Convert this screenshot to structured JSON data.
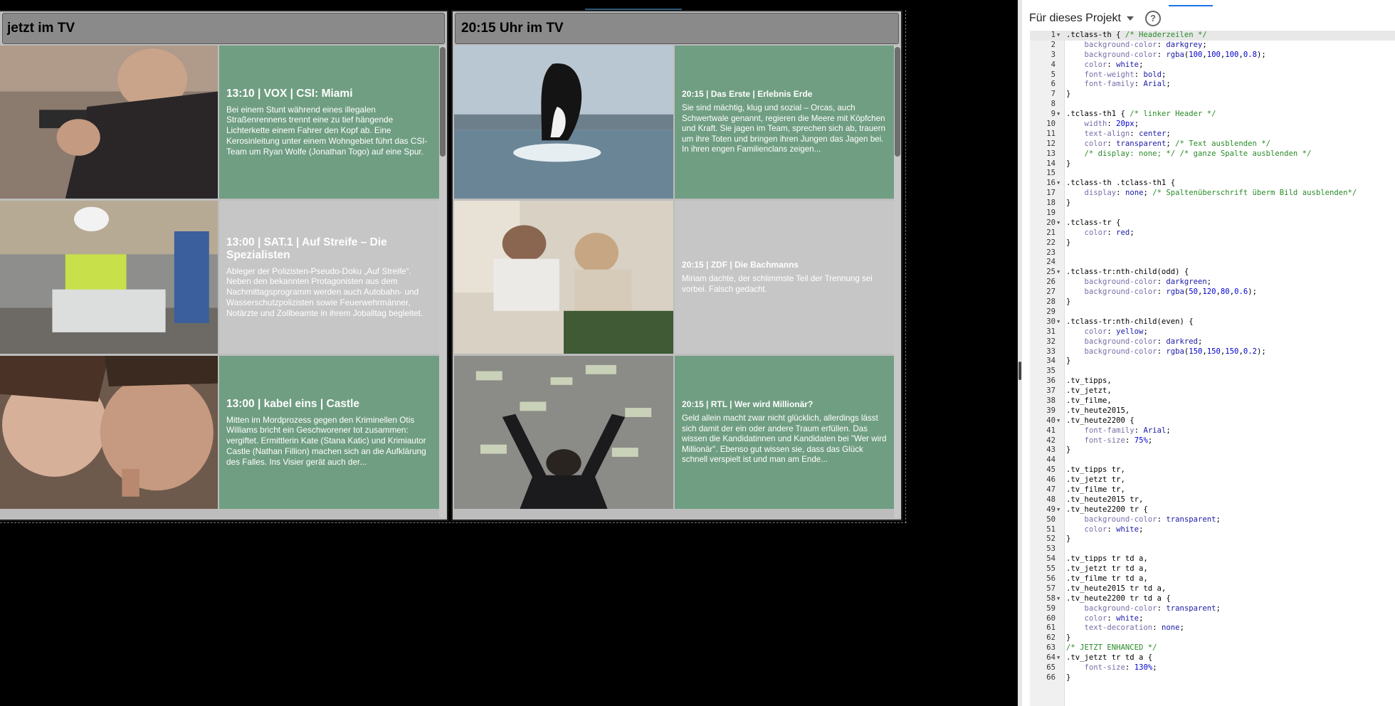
{
  "preview": {
    "panels": [
      {
        "id": "jetzt",
        "header": "jetzt im TV",
        "rows": [
          {
            "title": "13:10 | VOX | CSI: Miami",
            "description": "Bei einem Stunt während eines illegalen Straßenrennens trennt eine zu tief hängende Lichterkette einem Fahrer den Kopf ab. Eine Kerosinleitung unter einem Wohngebiet führt das CSI-Team um Ryan Wolfe (Jonathan Togo) auf eine Spur.",
            "image": "man-with-gun"
          },
          {
            "title": "13:00 | SAT.1 | Auf Streife – Die Spezialisten",
            "description": "Ableger der Polizisten-Pseudo-Doku „Auf Streife“. Neben den bekannten Protagonisten aus dem Nachmittagsprogramm werden auch Autobahn- und Wasserschutzpolizisten sowie Feuerwehrmänner, Notärzte und Zollbeamte in ihrem Joballtag begleitet.",
            "image": "police-motorcycle"
          },
          {
            "title": "13:00 | kabel eins | Castle",
            "description": "Mitten im Mordprozess gegen den Kriminellen Otis Williams bricht ein Geschworener tot zusammen: vergiftet. Ermittlerin Kate (Stana Katic) und Krimiautor Castle (Nathan Fillion) machen sich an die Aufklärung des Falles. Ins Visier gerät auch der...",
            "image": "castle-couple"
          }
        ]
      },
      {
        "id": "2015",
        "header": "20:15 Uhr im TV",
        "rows": [
          {
            "title": "20:15 | Das Erste | Erlebnis Erde",
            "description": "Sie sind mächtig, klug und sozial – Orcas, auch Schwertwale genannt, regieren die Meere mit Köpfchen und Kraft. Sie jagen im Team, sprechen sich ab, trauern um ihre Toten und bringen ihren Jungen das Jagen bei. In ihren engen Familienclans zeigen...",
            "image": "orca-jumping"
          },
          {
            "title": "20:15 | ZDF | Die Bachmanns",
            "description": "Miriam dachte, der schlimmste Teil der Trennung sei vorbei. Falsch gedacht.",
            "image": "couple-sitting"
          },
          {
            "title": "20:15 | RTL | Wer wird Millionär?",
            "description": "Geld allein macht zwar nicht glücklich, allerdings lässt sich damit der ein oder andere Traum erfüllen. Das wissen die Kandidatinnen und Kandidaten bei \"Wer wird Millionär\". Ebenso gut wissen sie, dass das Glück schnell verspielt ist und man am Ende...",
            "image": "money-rain"
          }
        ]
      }
    ]
  },
  "editor": {
    "project_label": "Für dieses Projekt",
    "help_icon": "question-circle-icon",
    "lines": [
      {
        "n": 1,
        "fold": true,
        "segs": [
          [
            "sel",
            ".tclass-th { "
          ],
          [
            "cm",
            "/* Headerzeilen */"
          ]
        ]
      },
      {
        "n": 2,
        "segs": [
          [
            "prop",
            "    background-color"
          ],
          [
            "sel",
            ": "
          ],
          [
            "kw",
            "darkgrey"
          ],
          [
            "sel",
            ";"
          ]
        ]
      },
      {
        "n": 3,
        "segs": [
          [
            "prop",
            "    background-color"
          ],
          [
            "sel",
            ": "
          ],
          [
            "fn",
            "rgba"
          ],
          [
            "sel",
            "("
          ],
          [
            "num",
            "100"
          ],
          [
            "sel",
            ","
          ],
          [
            "num",
            "100"
          ],
          [
            "sel",
            ","
          ],
          [
            "num",
            "100"
          ],
          [
            "sel",
            ","
          ],
          [
            "num",
            "0.8"
          ],
          [
            "sel",
            ");"
          ]
        ]
      },
      {
        "n": 4,
        "segs": [
          [
            "prop",
            "    color"
          ],
          [
            "sel",
            ": "
          ],
          [
            "kw",
            "white"
          ],
          [
            "sel",
            ";"
          ]
        ]
      },
      {
        "n": 5,
        "segs": [
          [
            "prop",
            "    font-weight"
          ],
          [
            "sel",
            ": "
          ],
          [
            "kw",
            "bold"
          ],
          [
            "sel",
            ";"
          ]
        ]
      },
      {
        "n": 6,
        "segs": [
          [
            "prop",
            "    font-family"
          ],
          [
            "sel",
            ": "
          ],
          [
            "kw",
            "Arial"
          ],
          [
            "sel",
            ";"
          ]
        ]
      },
      {
        "n": 7,
        "segs": [
          [
            "sel",
            "}"
          ]
        ]
      },
      {
        "n": 8,
        "segs": []
      },
      {
        "n": 9,
        "fold": true,
        "segs": [
          [
            "sel",
            ".tclass-th1 { "
          ],
          [
            "cm",
            "/* linker Header */"
          ]
        ]
      },
      {
        "n": 10,
        "segs": [
          [
            "prop",
            "    width"
          ],
          [
            "sel",
            ": "
          ],
          [
            "num",
            "20px"
          ],
          [
            "sel",
            ";"
          ]
        ]
      },
      {
        "n": 11,
        "segs": [
          [
            "prop",
            "    text-align"
          ],
          [
            "sel",
            ": "
          ],
          [
            "kw",
            "center"
          ],
          [
            "sel",
            ";"
          ]
        ]
      },
      {
        "n": 12,
        "segs": [
          [
            "prop",
            "    color"
          ],
          [
            "sel",
            ": "
          ],
          [
            "kw",
            "transparent"
          ],
          [
            "sel",
            "; "
          ],
          [
            "cm",
            "/* Text ausblenden */"
          ]
        ]
      },
      {
        "n": 13,
        "segs": [
          [
            "cm",
            "    /* display: none; */ /* ganze Spalte ausblenden */"
          ]
        ]
      },
      {
        "n": 14,
        "segs": [
          [
            "sel",
            "}"
          ]
        ]
      },
      {
        "n": 15,
        "segs": []
      },
      {
        "n": 16,
        "fold": true,
        "segs": [
          [
            "sel",
            ".tclass-th .tclass-th1 {"
          ]
        ]
      },
      {
        "n": 17,
        "segs": [
          [
            "prop",
            "    display"
          ],
          [
            "sel",
            ": "
          ],
          [
            "kw",
            "none"
          ],
          [
            "sel",
            "; "
          ],
          [
            "cm",
            "/* Spaltenüberschrift überm Bild ausblenden*/"
          ]
        ]
      },
      {
        "n": 18,
        "segs": [
          [
            "sel",
            "}"
          ]
        ]
      },
      {
        "n": 19,
        "segs": []
      },
      {
        "n": 20,
        "fold": true,
        "segs": [
          [
            "sel",
            ".tclass-tr {"
          ]
        ]
      },
      {
        "n": 21,
        "segs": [
          [
            "prop",
            "    color"
          ],
          [
            "sel",
            ": "
          ],
          [
            "kw",
            "red"
          ],
          [
            "sel",
            ";"
          ]
        ]
      },
      {
        "n": 22,
        "segs": [
          [
            "sel",
            "}"
          ]
        ]
      },
      {
        "n": 23,
        "segs": []
      },
      {
        "n": 24,
        "segs": []
      },
      {
        "n": 25,
        "fold": true,
        "segs": [
          [
            "sel",
            ".tclass-tr:nth-child(odd) {"
          ]
        ]
      },
      {
        "n": 26,
        "segs": [
          [
            "prop",
            "    background-color"
          ],
          [
            "sel",
            ": "
          ],
          [
            "kw",
            "darkgreen"
          ],
          [
            "sel",
            ";"
          ]
        ]
      },
      {
        "n": 27,
        "segs": [
          [
            "prop",
            "    background-color"
          ],
          [
            "sel",
            ": "
          ],
          [
            "fn",
            "rgba"
          ],
          [
            "sel",
            "("
          ],
          [
            "num",
            "50"
          ],
          [
            "sel",
            ","
          ],
          [
            "num",
            "120"
          ],
          [
            "sel",
            ","
          ],
          [
            "num",
            "80"
          ],
          [
            "sel",
            ","
          ],
          [
            "num",
            "0.6"
          ],
          [
            "sel",
            ");"
          ]
        ]
      },
      {
        "n": 28,
        "segs": [
          [
            "sel",
            "}"
          ]
        ]
      },
      {
        "n": 29,
        "segs": []
      },
      {
        "n": 30,
        "fold": true,
        "segs": [
          [
            "sel",
            ".tclass-tr:nth-child(even) {"
          ]
        ]
      },
      {
        "n": 31,
        "segs": [
          [
            "prop",
            "    color"
          ],
          [
            "sel",
            ": "
          ],
          [
            "kw",
            "yellow"
          ],
          [
            "sel",
            ";"
          ]
        ]
      },
      {
        "n": 32,
        "segs": [
          [
            "prop",
            "    background-color"
          ],
          [
            "sel",
            ": "
          ],
          [
            "kw",
            "darkred"
          ],
          [
            "sel",
            ";"
          ]
        ]
      },
      {
        "n": 33,
        "segs": [
          [
            "prop",
            "    background-color"
          ],
          [
            "sel",
            ": "
          ],
          [
            "fn",
            "rgba"
          ],
          [
            "sel",
            "("
          ],
          [
            "num",
            "150"
          ],
          [
            "sel",
            ","
          ],
          [
            "num",
            "150"
          ],
          [
            "sel",
            ","
          ],
          [
            "num",
            "150"
          ],
          [
            "sel",
            ","
          ],
          [
            "num",
            "0.2"
          ],
          [
            "sel",
            ");"
          ]
        ]
      },
      {
        "n": 34,
        "segs": [
          [
            "sel",
            "}"
          ]
        ]
      },
      {
        "n": 35,
        "segs": []
      },
      {
        "n": 36,
        "segs": [
          [
            "sel",
            ".tv_tipps,"
          ]
        ]
      },
      {
        "n": 37,
        "segs": [
          [
            "sel",
            ".tv_jetzt,"
          ]
        ]
      },
      {
        "n": 38,
        "segs": [
          [
            "sel",
            ".tv_filme,"
          ]
        ]
      },
      {
        "n": 39,
        "segs": [
          [
            "sel",
            ".tv_heute2015,"
          ]
        ]
      },
      {
        "n": 40,
        "fold": true,
        "segs": [
          [
            "sel",
            ".tv_heute2200 {"
          ]
        ]
      },
      {
        "n": 41,
        "segs": [
          [
            "prop",
            "    font-family"
          ],
          [
            "sel",
            ": "
          ],
          [
            "kw",
            "Arial"
          ],
          [
            "sel",
            ";"
          ]
        ]
      },
      {
        "n": 42,
        "segs": [
          [
            "prop",
            "    font-size"
          ],
          [
            "sel",
            ": "
          ],
          [
            "num",
            "75%"
          ],
          [
            "sel",
            ";"
          ]
        ]
      },
      {
        "n": 43,
        "segs": [
          [
            "sel",
            "}"
          ]
        ]
      },
      {
        "n": 44,
        "segs": []
      },
      {
        "n": 45,
        "segs": [
          [
            "sel",
            ".tv_tipps tr,"
          ]
        ]
      },
      {
        "n": 46,
        "segs": [
          [
            "sel",
            ".tv_jetzt tr,"
          ]
        ]
      },
      {
        "n": 47,
        "segs": [
          [
            "sel",
            ".tv_filme tr,"
          ]
        ]
      },
      {
        "n": 48,
        "segs": [
          [
            "sel",
            ".tv_heute2015 tr,"
          ]
        ]
      },
      {
        "n": 49,
        "fold": true,
        "segs": [
          [
            "sel",
            ".tv_heute2200 tr {"
          ]
        ]
      },
      {
        "n": 50,
        "segs": [
          [
            "prop",
            "    background-color"
          ],
          [
            "sel",
            ": "
          ],
          [
            "kw",
            "transparent"
          ],
          [
            "sel",
            ";"
          ]
        ]
      },
      {
        "n": 51,
        "segs": [
          [
            "prop",
            "    color"
          ],
          [
            "sel",
            ": "
          ],
          [
            "kw",
            "white"
          ],
          [
            "sel",
            ";"
          ]
        ]
      },
      {
        "n": 52,
        "segs": [
          [
            "sel",
            "}"
          ]
        ]
      },
      {
        "n": 53,
        "segs": []
      },
      {
        "n": 54,
        "segs": [
          [
            "sel",
            ".tv_tipps tr td a,"
          ]
        ]
      },
      {
        "n": 55,
        "segs": [
          [
            "sel",
            ".tv_jetzt tr td a,"
          ]
        ]
      },
      {
        "n": 56,
        "segs": [
          [
            "sel",
            ".tv_filme tr td a,"
          ]
        ]
      },
      {
        "n": 57,
        "segs": [
          [
            "sel",
            ".tv_heute2015 tr td a,"
          ]
        ]
      },
      {
        "n": 58,
        "fold": true,
        "segs": [
          [
            "sel",
            ".tv_heute2200 tr td a {"
          ]
        ]
      },
      {
        "n": 59,
        "segs": [
          [
            "prop",
            "    background-color"
          ],
          [
            "sel",
            ": "
          ],
          [
            "kw",
            "transparent"
          ],
          [
            "sel",
            ";"
          ]
        ]
      },
      {
        "n": 60,
        "segs": [
          [
            "prop",
            "    color"
          ],
          [
            "sel",
            ": "
          ],
          [
            "kw",
            "white"
          ],
          [
            "sel",
            ";"
          ]
        ]
      },
      {
        "n": 61,
        "segs": [
          [
            "prop",
            "    text-decoration"
          ],
          [
            "sel",
            ": "
          ],
          [
            "kw",
            "none"
          ],
          [
            "sel",
            ";"
          ]
        ]
      },
      {
        "n": 62,
        "segs": [
          [
            "sel",
            "}"
          ]
        ]
      },
      {
        "n": 63,
        "segs": [
          [
            "cm",
            "/* JETZT ENHANCED */"
          ]
        ]
      },
      {
        "n": 64,
        "fold": true,
        "segs": [
          [
            "sel",
            ".tv_jetzt tr td a {"
          ]
        ]
      },
      {
        "n": 65,
        "segs": [
          [
            "prop",
            "    font-size"
          ],
          [
            "sel",
            ": "
          ],
          [
            "num",
            "130%"
          ],
          [
            "sel",
            ";"
          ]
        ]
      },
      {
        "n": 66,
        "segs": [
          [
            "sel",
            "}"
          ]
        ]
      }
    ]
  }
}
